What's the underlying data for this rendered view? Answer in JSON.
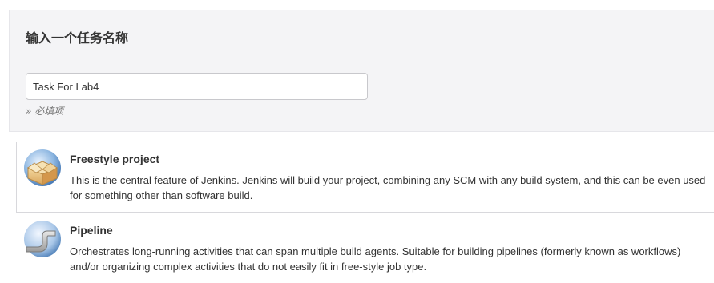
{
  "header": {
    "title": "输入一个任务名称",
    "name_input_value": "Task For Lab4",
    "required_hint": "» 必填项"
  },
  "job_types": [
    {
      "icon": "freestyle-box-icon",
      "title": "Freestyle project",
      "description": "This is the central feature of Jenkins. Jenkins will build your project, combining any SCM with any build system, and this can be even used for something other than software build."
    },
    {
      "icon": "pipeline-icon",
      "title": "Pipeline",
      "description": "Orchestrates long-running activities that can span multiple build agents. Suitable for building pipelines (formerly known as workflows) and/or organizing complex activities that do not easily fit in free-style job type."
    }
  ]
}
